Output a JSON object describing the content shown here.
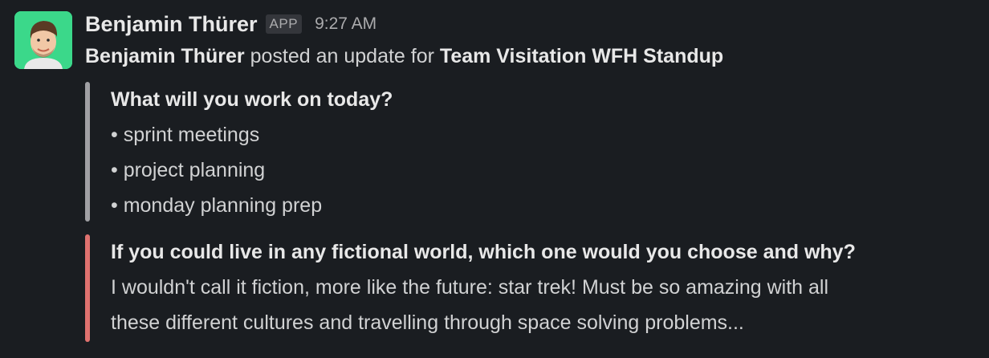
{
  "message": {
    "sender": "Benjamin Thürer",
    "badge": "APP",
    "time": "9:27 AM",
    "avatar_bg": "#3bd88a"
  },
  "update": {
    "author": "Benjamin Thürer",
    "text": " posted an update for ",
    "team": "Team Visitation WFH Standup"
  },
  "attachments": [
    {
      "accent": "#a0a0a4",
      "question": "What will you work on today?",
      "items": [
        "• sprint meetings",
        "• project planning",
        "• monday planning prep"
      ]
    },
    {
      "accent": "#e0726f",
      "question": "If you could live in any fictional world, which one would you choose and why?",
      "lines": [
        "I wouldn't call it fiction, more like the future: star trek! Must be so amazing with all",
        "these different cultures and travelling through space solving problems..."
      ]
    }
  ]
}
